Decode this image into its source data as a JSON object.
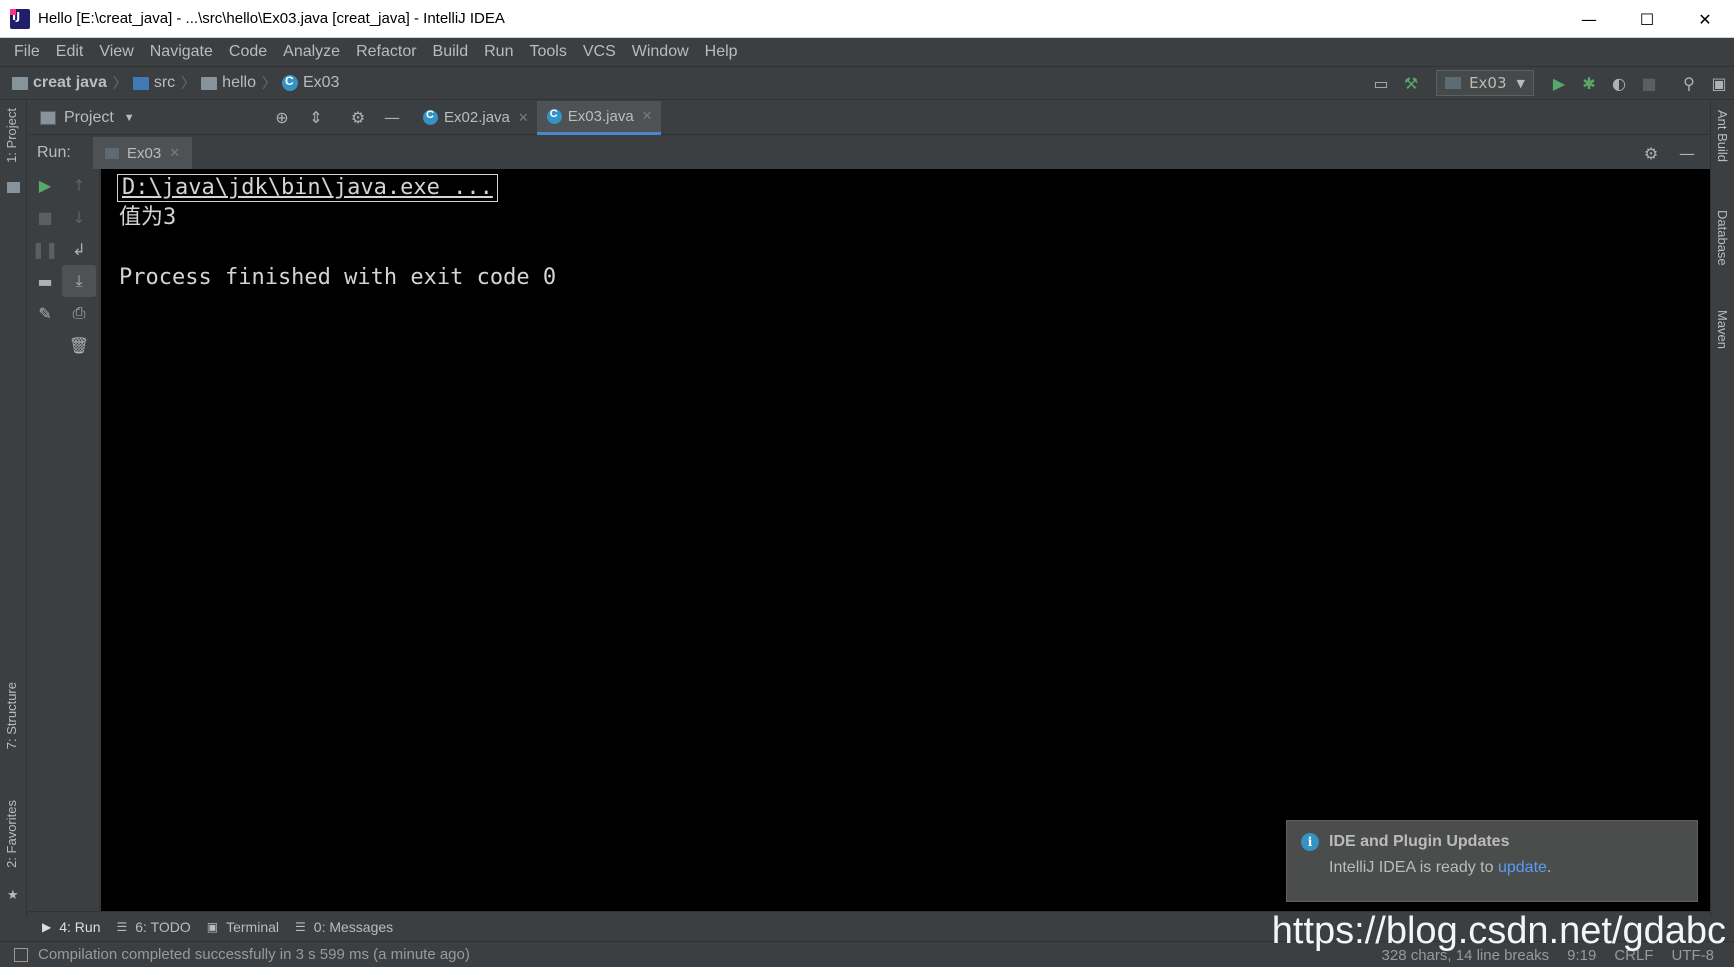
{
  "window": {
    "title": "Hello [E:\\creat_java] - ...\\src\\hello\\Ex03.java [creat_java] - IntelliJ IDEA",
    "minimize": "—",
    "maximize": "☐",
    "close": "✕"
  },
  "menu": [
    "File",
    "Edit",
    "View",
    "Navigate",
    "Code",
    "Analyze",
    "Refactor",
    "Build",
    "Run",
    "Tools",
    "VCS",
    "Window",
    "Help"
  ],
  "breadcrumb": {
    "project": "creat java",
    "folder1": "src",
    "folder2": "hello",
    "file": "Ex03"
  },
  "toolbar": {
    "run_config": "Ex03"
  },
  "project_panel": {
    "label": "Project"
  },
  "editor_tabs": [
    {
      "label": "Ex02.java",
      "active": false
    },
    {
      "label": "Ex03.java",
      "active": true
    }
  ],
  "run_panel": {
    "label": "Run:",
    "tab": "Ex03"
  },
  "console": {
    "command": "D:\\java\\jdk\\bin\\java.exe ...",
    "output": "值为3",
    "blank": "",
    "exit": "Process finished with exit code 0"
  },
  "left_stripe": {
    "project": "1: Project",
    "structure": "7: Structure",
    "favorites": "2: Favorites"
  },
  "right_stripe": {
    "ant": "Ant Build",
    "database": "Database",
    "maven": "Maven"
  },
  "notification": {
    "title": "IDE and Plugin Updates",
    "body_prefix": "IntelliJ IDEA is ready to ",
    "link": "update",
    "body_suffix": "."
  },
  "bottom_tabs": [
    {
      "label": "4: Run",
      "icon": "run-triangle-icon"
    },
    {
      "label": "6: TODO",
      "icon": "list-icon"
    },
    {
      "label": "Terminal",
      "icon": "terminal-icon"
    },
    {
      "label": "0: Messages",
      "icon": "messages-icon"
    }
  ],
  "status": {
    "message": "Compilation completed successfully in 3 s 599 ms (a minute ago)",
    "chars": "328 chars, 14 line breaks",
    "position": "9:19",
    "line_sep": "CRLF",
    "encoding": "UTF-8"
  },
  "watermark": "https://blog.csdn.net/gdabc"
}
